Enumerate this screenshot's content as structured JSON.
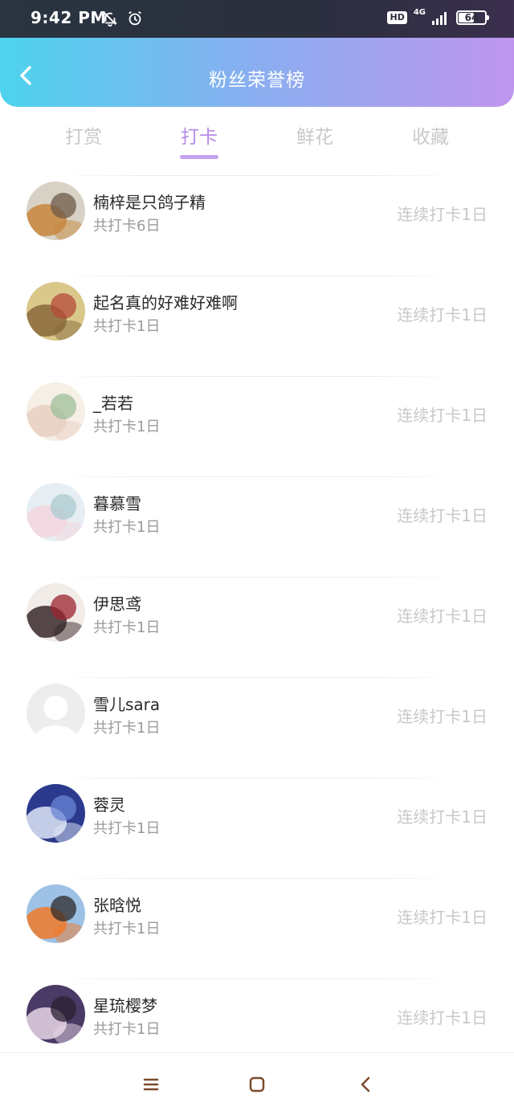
{
  "status_bar": {
    "time": "9:42 PM",
    "hd": "HD",
    "network": "4G",
    "battery": "64",
    "battery_level": 0.64,
    "icons": [
      "bell-muted-icon",
      "alarm-clock-icon",
      "hd-icon",
      "signal-icon",
      "battery-icon"
    ]
  },
  "header": {
    "title": "粉丝荣誉榜",
    "back_icon": "chevron-left-icon"
  },
  "tabs": [
    {
      "label": "打赏",
      "active": false
    },
    {
      "label": "打卡",
      "active": true
    },
    {
      "label": "鲜花",
      "active": false
    },
    {
      "label": "收藏",
      "active": false
    }
  ],
  "colors": {
    "accent": "#b58be8",
    "header_gradient_start": "#4dd3ee",
    "header_gradient_end": "#bf96ee",
    "inactive_tab": "#c9c9c9"
  },
  "fans": [
    {
      "name": "楠梓是只鸽子精",
      "total": "共打卡6日",
      "streak": "连续打卡1日",
      "avatar_colors": [
        "#d8d2c6",
        "#c8863c",
        "#6e5a48"
      ]
    },
    {
      "name": "起名真的好难好难啊",
      "total": "共打卡1日",
      "streak": "连续打卡1日",
      "avatar_colors": [
        "#d9c88a",
        "#8a6a3c",
        "#b54b3a"
      ]
    },
    {
      "name": "_若若",
      "total": "共打卡1日",
      "streak": "连续打卡1日",
      "avatar_colors": [
        "#f6efe6",
        "#e8cfc2",
        "#9dbf9a"
      ]
    },
    {
      "name": "暮慕雪",
      "total": "共打卡1日",
      "streak": "连续打卡1日",
      "avatar_colors": [
        "#e7eef3",
        "#f3d6de",
        "#a9c9cf"
      ]
    },
    {
      "name": "伊思鸢",
      "total": "共打卡1日",
      "streak": "连续打卡1日",
      "avatar_colors": [
        "#f2ece8",
        "#3a2a2a",
        "#9c2430"
      ]
    },
    {
      "name": "雪儿sara",
      "total": "共打卡1日",
      "streak": "连续打卡1日",
      "avatar_colors": [
        "#ededed",
        "#dcdcdc",
        "#ffffff"
      ]
    },
    {
      "name": "蓉灵",
      "total": "共打卡1日",
      "streak": "连续打卡1日",
      "avatar_colors": [
        "#2b3a8c",
        "#dfe8f7",
        "#6a86d6"
      ]
    },
    {
      "name": "张晗悦",
      "total": "共打卡1日",
      "streak": "连续打卡1日",
      "avatar_colors": [
        "#9dc2e6",
        "#f07a2a",
        "#2f2a2a"
      ]
    },
    {
      "name": "星琉樱梦",
      "total": "共打卡1日",
      "streak": "连续打卡1日",
      "avatar_colors": [
        "#4a3a66",
        "#e8d6e6",
        "#2a2030"
      ]
    }
  ],
  "nav_bar": {
    "icons": [
      "menu-icon",
      "home-square-icon",
      "back-triangle-icon"
    ]
  }
}
